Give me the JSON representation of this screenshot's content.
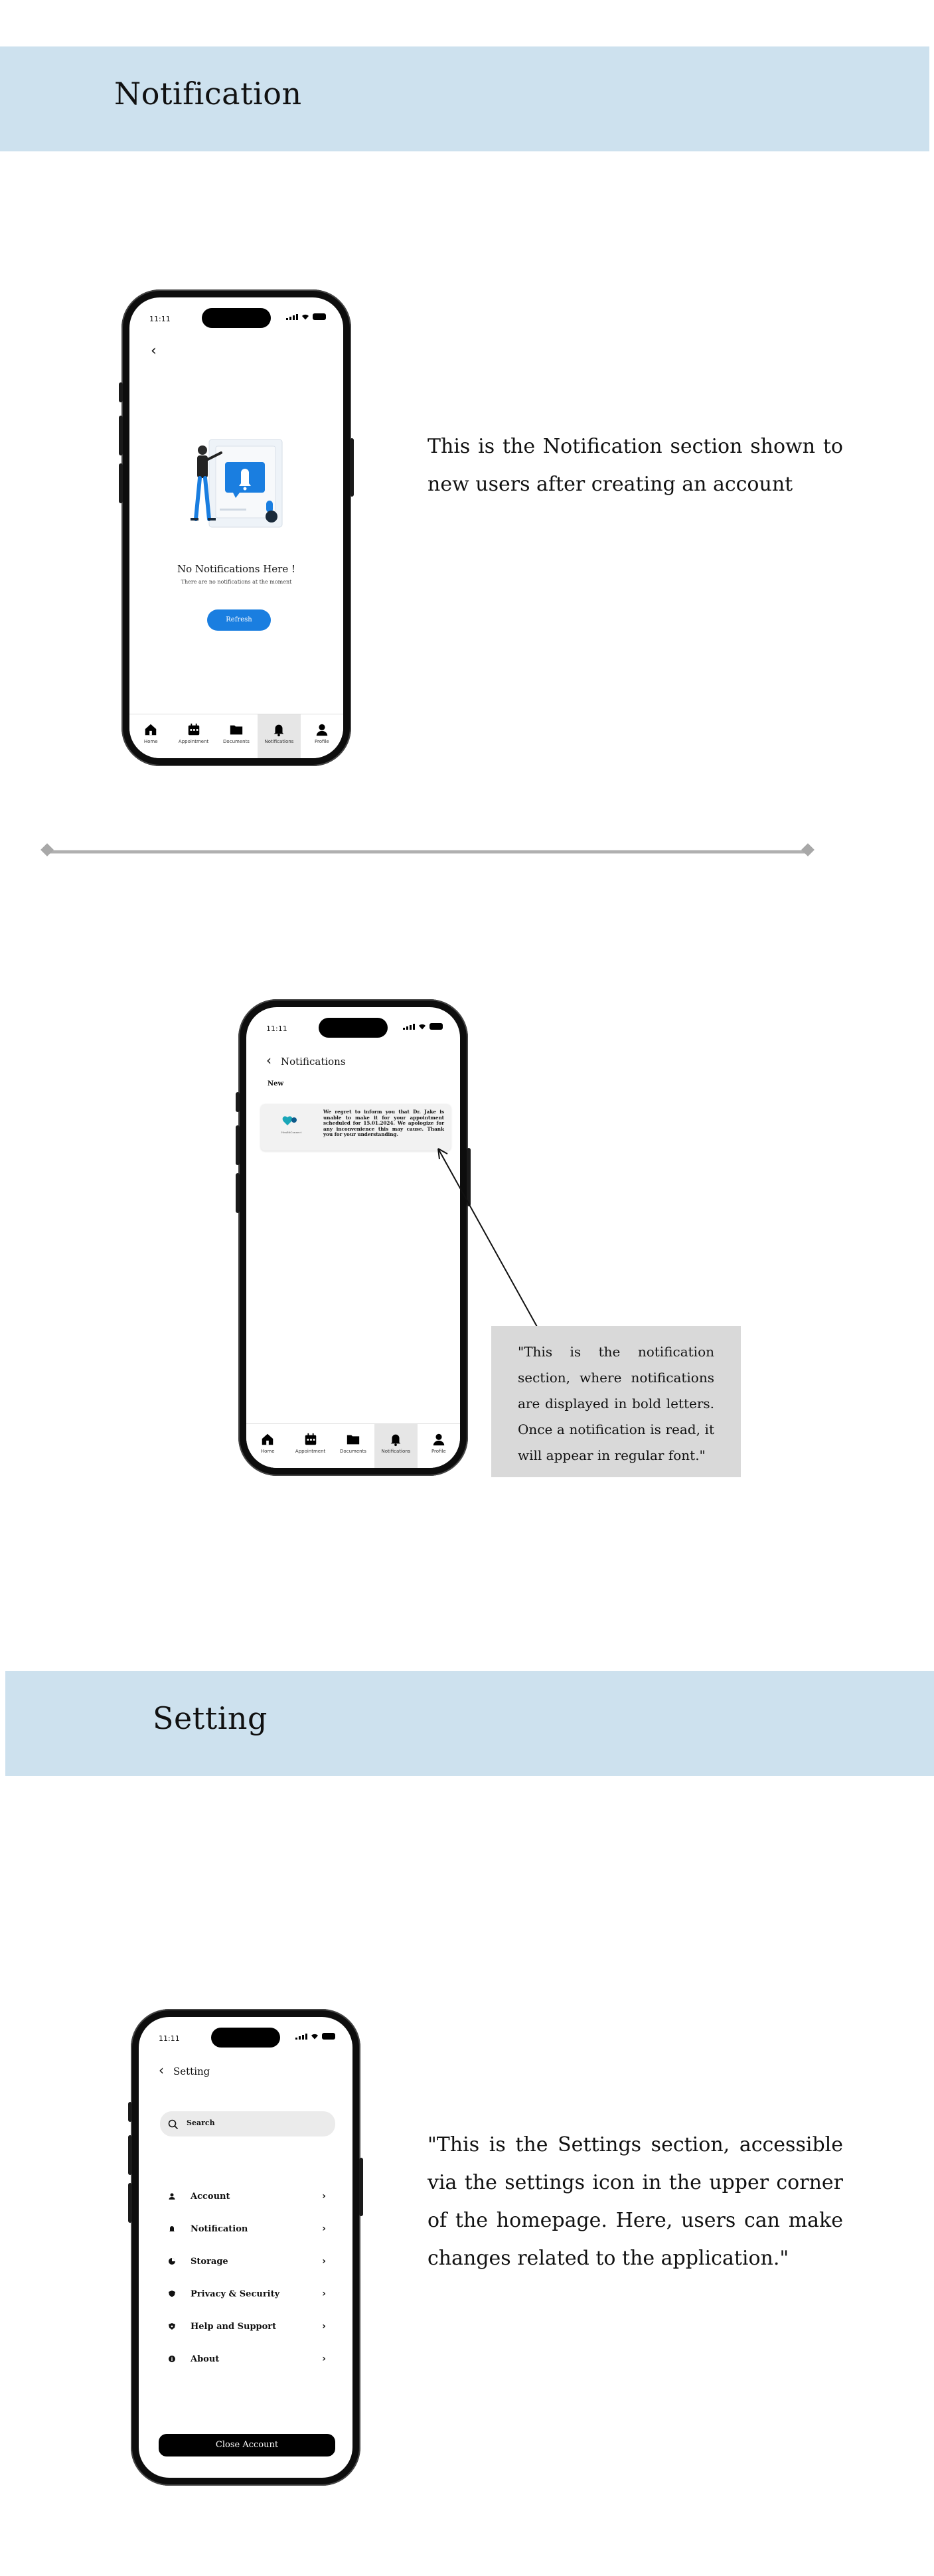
{
  "sections": {
    "notification_title": "Notification",
    "setting_title": "Setting"
  },
  "phone1": {
    "time": "11:11",
    "empty_title": "No Notifications Here !",
    "empty_sub": "There are no notifications at the moment",
    "refresh_label": "Refresh"
  },
  "tabs": {
    "home": "Home",
    "appointment": "Appointment",
    "documents": "Documents",
    "notifications": "Notifications",
    "profile": "Profile"
  },
  "description1": "This is the Notification  section shown to new users after creating an account",
  "phone2": {
    "time": "11:11",
    "header": "Notifications",
    "group_new": "New",
    "message": "We regret to inform you that Dr. Jake is unable to make it for your appointment scheduled for 15.01.2024. We apologize for any inconvenience this may cause. Thank you for your understanding.",
    "logo_text": "HealthConnect"
  },
  "callout": "\"This is the notification section, where notifications are displayed in bold letters. Once a notification is read, it will appear in regular font.\"",
  "phone3": {
    "time": "11:11",
    "header": "Setting",
    "search_placeholder": "Search",
    "items": [
      "Account",
      "Notification",
      "Storage",
      "Privacy & Security",
      "Help and Support",
      "About"
    ],
    "close_label": "Close Account"
  },
  "description3": "\"This is the Settings section, accessible via the settings icon in the upper corner of the homepage. Here, users can make changes related to the application.\"",
  "colors": {
    "band": "#cde1ee",
    "accent_blue": "#1a7ee0",
    "callout_bg": "#d9d9d9"
  }
}
